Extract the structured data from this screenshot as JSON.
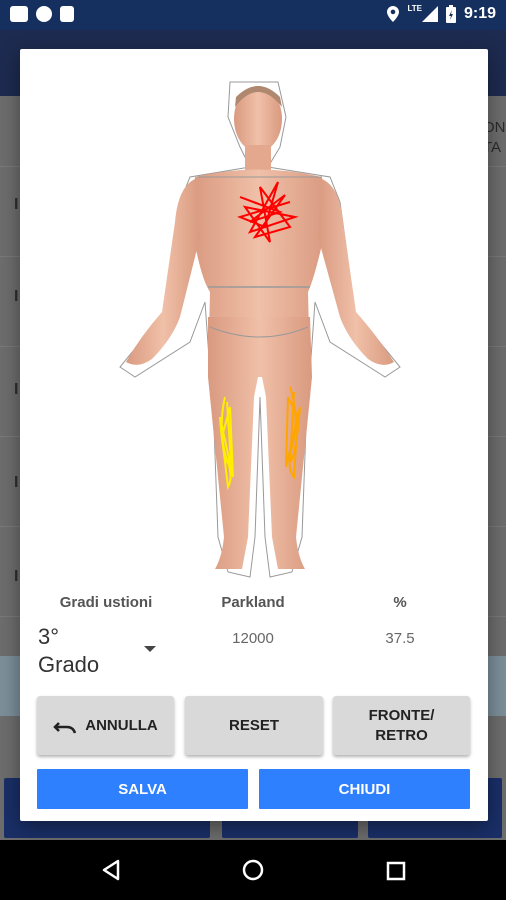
{
  "status_bar": {
    "time": "9:19",
    "network": "LTE"
  },
  "dialog": {
    "columns": {
      "grade_header": "Gradi ustioni",
      "parkland_header": "Parkland",
      "percent_header": "%"
    },
    "grade_select": {
      "line1": "3°",
      "line2": "Grado"
    },
    "parkland_value": "12000",
    "percent_value": "37.5",
    "buttons": {
      "undo": "ANNULLA",
      "reset": "RESET",
      "front_back_line1": "FRONTE/",
      "front_back_line2": "RETRO",
      "save": "SALVA",
      "close": "CHIUDI"
    },
    "burn_colors": {
      "third_degree": "#ff0000",
      "first_degree": "#ffee00",
      "second_degree": "#ffa500"
    },
    "accent": "#2f80ff"
  },
  "background": {
    "right_text_line1": "ON",
    "right_text_line2": "TA"
  }
}
